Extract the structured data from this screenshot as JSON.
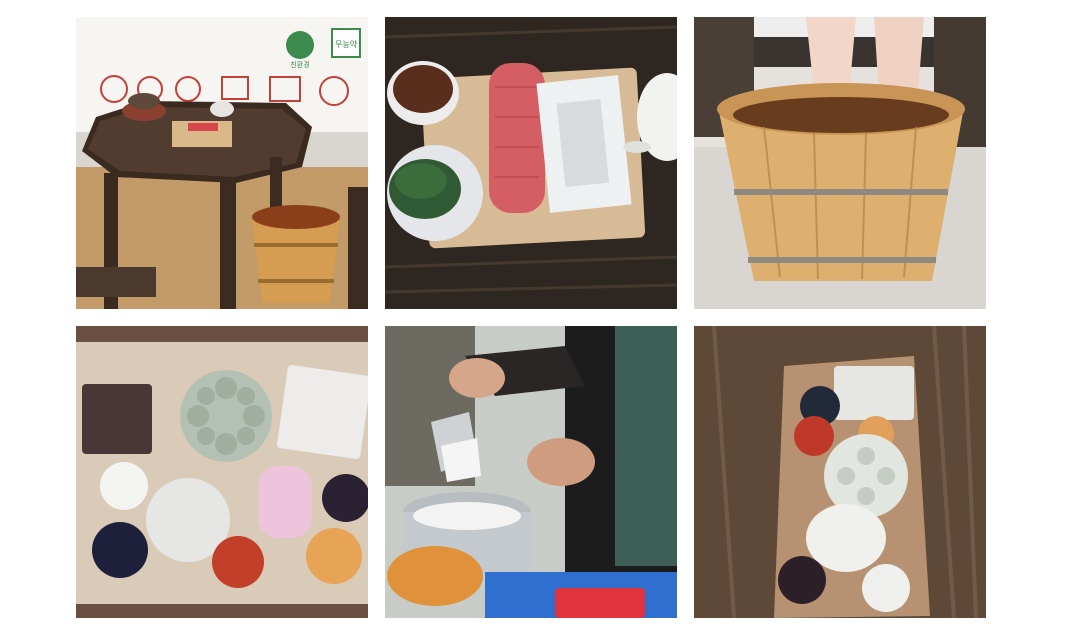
{
  "gallery": {
    "photos": [
      {
        "subject": "tea-table-with-foot-bath-tub",
        "logo_text": [
          "무농약",
          "친환경"
        ]
      },
      {
        "subject": "tea-tray-with-rice-cake-and-towel"
      },
      {
        "subject": "feet-in-wooden-bath-bucket"
      },
      {
        "subject": "handmade-soaps-on-wooden-board"
      },
      {
        "subject": "pouring-milk-soap-base"
      },
      {
        "subject": "soaps-on-long-wooden-tray"
      }
    ]
  }
}
